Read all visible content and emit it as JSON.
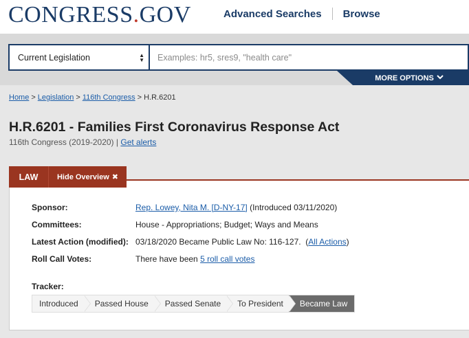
{
  "header": {
    "logo_main": "CONGRESS",
    "logo_dot": ".",
    "logo_tld": "GOV",
    "nav": [
      "Advanced Searches",
      "Browse"
    ]
  },
  "search": {
    "scope": "Current Legislation",
    "placeholder": "Examples: hr5, sres9, \"health care\"",
    "value": "",
    "more_options": "MORE OPTIONS"
  },
  "breadcrumb": {
    "items": [
      "Home",
      "Legislation",
      "116th Congress"
    ],
    "current": "H.R.6201"
  },
  "bill": {
    "title": "H.R.6201 - Families First Coronavirus Response Act",
    "congress": "116th Congress (2019-2020)",
    "divider": "|",
    "alerts_link": "Get alerts"
  },
  "tabs": {
    "status": "LAW",
    "hide_overview": "Hide Overview"
  },
  "overview": {
    "sponsor_label": "Sponsor:",
    "sponsor_name": "Rep. Lowey, Nita M. [D-NY-17]",
    "sponsor_intro": "(Introduced 03/11/2020)",
    "committees_label": "Committees:",
    "committees_value": "House - Appropriations; Budget; Ways and Means",
    "latest_action_label": "Latest Action (modified):",
    "latest_action_value": "03/18/2020 Became Public Law No: 116-127.",
    "all_actions_open": "(",
    "all_actions_link": "All Actions",
    "all_actions_close": ")",
    "roll_call_label": "Roll Call Votes:",
    "roll_call_prefix": "There have been",
    "roll_call_link": "5 roll call votes",
    "tracker_label": "Tracker:",
    "tracker_steps": [
      "Introduced",
      "Passed House",
      "Passed Senate",
      "To President",
      "Became Law"
    ],
    "tracker_current_index": 4
  },
  "colors": {
    "brand_navy": "#1a3b66",
    "law_red": "#9a3520",
    "link_blue": "#1a5ca8",
    "tracker_current": "#6b6b6b"
  }
}
